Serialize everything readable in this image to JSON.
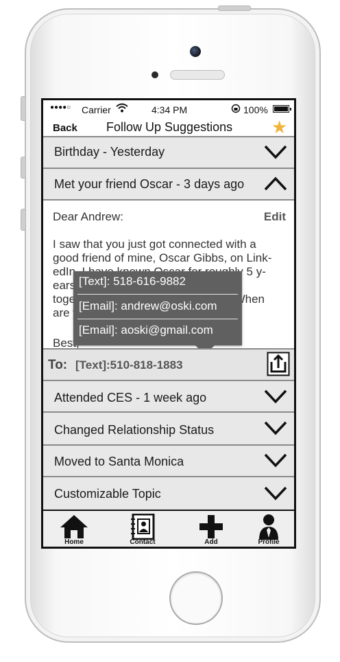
{
  "status_bar": {
    "signal_dots": "●●●●○",
    "carrier": "Carrier",
    "time": "4:34 PM",
    "battery_percent": "100%"
  },
  "nav": {
    "back_label": "Back",
    "title": "Follow Up Suggestions",
    "star_icon": "star-icon",
    "accent_color": "#f0b43c"
  },
  "items": [
    {
      "label": "Birthday - Yesterday",
      "expanded": false
    },
    {
      "label": "Met your friend Oscar - 3 days ago",
      "expanded": true
    },
    {
      "label": "Attended CES - 1 week ago",
      "expanded": false
    },
    {
      "label": "Changed Relationship Status",
      "expanded": false
    },
    {
      "label": "Moved to Santa Monica",
      "expanded": false
    },
    {
      "label": "Customizable Topic",
      "expanded": false
    }
  ],
  "message": {
    "greeting": "Dear Andrew:",
    "edit_label": "Edit",
    "body_lines": [
      "I saw that you just got connected with a",
      "good friend of mine, Oscar Gibbs, on Link-",
      "edIn.  I have known Oscar for roughly 5 y-",
      "ears. Why don't we all grab a bite",
      "together sometime next weekend?  When",
      "are you free?"
    ],
    "sign_off": "Best,"
  },
  "contact_popover": {
    "options": [
      "[Text]: 518-616-9882",
      "[Email]: andrew@oski.com",
      "[Email]: aoski@gmail.com"
    ]
  },
  "recipient": {
    "to_label": "To:",
    "value": "[Text]:510-818-1883",
    "share_icon": "share-icon"
  },
  "tabs": [
    {
      "label": "Home",
      "icon": "home-icon"
    },
    {
      "label": "Contact",
      "icon": "contact-book-icon"
    },
    {
      "label": "Add",
      "icon": "plus-icon"
    },
    {
      "label": "Profile",
      "icon": "profile-icon"
    }
  ]
}
